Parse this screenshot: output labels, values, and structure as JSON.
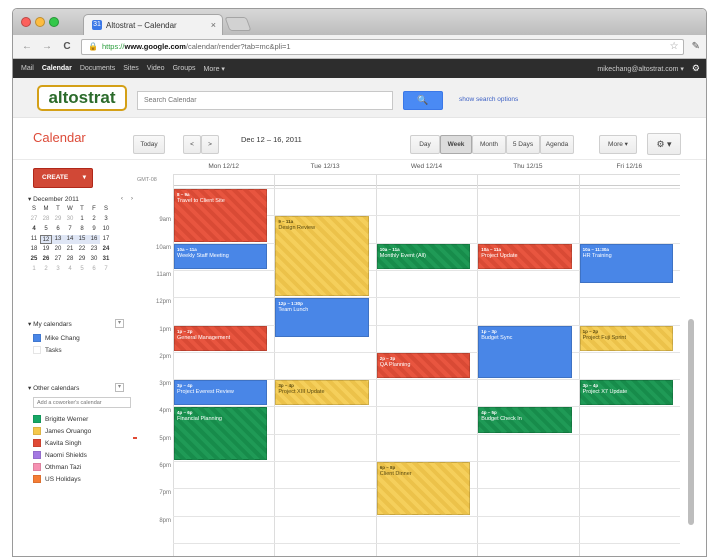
{
  "browser": {
    "tab_title": "Altostrat – Calendar",
    "tab_close": "×",
    "back": "←",
    "forward": "→",
    "reload": "C",
    "url_scheme": "https://",
    "url_host": "www.google.com",
    "url_path": "/calendar/render?tab=mc&pli=1",
    "star": "☆",
    "wrench": "✎"
  },
  "gbar": {
    "items": [
      "Mail",
      "Calendar",
      "Documents",
      "Sites",
      "Video",
      "Groups",
      "More ▾"
    ],
    "selected": "Calendar",
    "email": "mikechang@altostrat.com ▾",
    "gear": "⚙"
  },
  "header": {
    "logo": "altostrat",
    "search_placeholder": "Search Calendar",
    "search_icon": "🔍",
    "search_options": "show search options"
  },
  "toolbar": {
    "app_name": "Calendar",
    "today": "Today",
    "prev": "<",
    "next": ">",
    "date_range": "Dec 12 – 16, 2011",
    "views": [
      "Day",
      "Week",
      "Month",
      "5 Days",
      "Agenda"
    ],
    "active_view": "Week",
    "more": "More ▾",
    "settings": "⚙ ▾"
  },
  "sidebar": {
    "create": "CREATE",
    "create_arrow": "▾",
    "mini_title": "▾ December 2011",
    "mini_arrows": "‹ ›",
    "mini_days": [
      "S",
      "M",
      "T",
      "W",
      "T",
      "F",
      "S"
    ],
    "mini_weeks": [
      [
        "27",
        "28",
        "29",
        "30",
        "1",
        "2",
        "3"
      ],
      [
        "4",
        "5",
        "6",
        "7",
        "8",
        "9",
        "10"
      ],
      [
        "11",
        "12",
        "13",
        "14",
        "15",
        "16",
        "17"
      ],
      [
        "18",
        "19",
        "20",
        "21",
        "22",
        "23",
        "24"
      ],
      [
        "25",
        "26",
        "27",
        "28",
        "29",
        "30",
        "31"
      ],
      [
        "1",
        "2",
        "3",
        "4",
        "5",
        "6",
        "7"
      ]
    ],
    "my_calendars_title": "▾ My calendars",
    "my_calendars": [
      {
        "name": "Mike Chang",
        "color": "#4986e7"
      },
      {
        "name": "Tasks",
        "color": "#ffffff"
      }
    ],
    "other_calendars_title": "▾ Other calendars",
    "add_placeholder": "Add a coworker's calendar",
    "other_calendars": [
      {
        "name": "Brigitte Werner",
        "color": "#16a765"
      },
      {
        "name": "James Oruango",
        "color": "#f5c84c"
      },
      {
        "name": "Kavita Singh",
        "color": "#e04a35"
      },
      {
        "name": "Naomi Shields",
        "color": "#a479e2"
      },
      {
        "name": "Othman Tazi",
        "color": "#f691b2"
      },
      {
        "name": "US Holidays",
        "color": "#f57d35"
      }
    ],
    "section_box": "▾"
  },
  "grid": {
    "gmt": "GMT-08",
    "days": [
      "Mon 12/12",
      "Tue 12/13",
      "Wed 12/14",
      "Thu 12/15",
      "Fri 12/16"
    ],
    "hours": [
      "9am",
      "10am",
      "11am",
      "12pm",
      "1pm",
      "2pm",
      "3pm",
      "4pm",
      "5pm",
      "6pm",
      "7pm",
      "8pm"
    ]
  },
  "events": [
    {
      "day": 0,
      "start": 8.0,
      "end": 10.0,
      "time": "8 – 9a",
      "title": "Travel to Client Site",
      "color": "red"
    },
    {
      "day": 0,
      "start": 10.0,
      "end": 11.0,
      "time": "10a – 11a",
      "title": "Weekly Staff Meeting",
      "color": "blue"
    },
    {
      "day": 0,
      "start": 13.0,
      "end": 14.0,
      "time": "1p – 2p",
      "title": "General Management",
      "color": "red"
    },
    {
      "day": 0,
      "start": 15.0,
      "end": 16.0,
      "time": "3p – 4p",
      "title": "Project Everest Review",
      "color": "blue"
    },
    {
      "day": 0,
      "start": 16.0,
      "end": 18.0,
      "time": "4p – 6p",
      "title": "Financial Planning",
      "color": "green"
    },
    {
      "day": 1,
      "start": 9.0,
      "end": 12.0,
      "time": "9 – 11a",
      "title": "Design Review",
      "color": "yellow"
    },
    {
      "day": 1,
      "start": 12.0,
      "end": 13.5,
      "time": "12p – 1:30p",
      "title": "Team Lunch",
      "color": "blue"
    },
    {
      "day": 1,
      "start": 15.0,
      "end": 16.0,
      "time": "3p – 4p",
      "title": "Project XIII Update",
      "color": "yellow"
    },
    {
      "day": 2,
      "start": 10.0,
      "end": 11.0,
      "time": "10a – 11a",
      "title": "Monthly Event (All)",
      "color": "green"
    },
    {
      "day": 2,
      "start": 14.0,
      "end": 15.0,
      "time": "2p – 3p",
      "title": "QA Planning",
      "color": "red"
    },
    {
      "day": 2,
      "start": 18.0,
      "end": 20.0,
      "time": "6p – 8p",
      "title": "Client Dinner",
      "color": "yellow"
    },
    {
      "day": 3,
      "start": 10.0,
      "end": 11.0,
      "time": "10a – 11a",
      "title": "Project Update",
      "color": "red"
    },
    {
      "day": 3,
      "start": 13.0,
      "end": 15.0,
      "time": "1p – 3p",
      "title": "Budget Sync",
      "color": "blue"
    },
    {
      "day": 3,
      "start": 16.0,
      "end": 17.0,
      "time": "4p – 5p",
      "title": "Budget Check In",
      "color": "green"
    },
    {
      "day": 4,
      "start": 10.0,
      "end": 11.5,
      "time": "10a – 11:30a",
      "title": "HR Training",
      "color": "blue"
    },
    {
      "day": 4,
      "start": 13.0,
      "end": 14.0,
      "time": "1p – 2p",
      "title": "Project Fuji Sprint",
      "color": "yellow"
    },
    {
      "day": 4,
      "start": 15.0,
      "end": 16.0,
      "time": "3p – 4p",
      "title": "Project X7 Update",
      "color": "green"
    }
  ]
}
